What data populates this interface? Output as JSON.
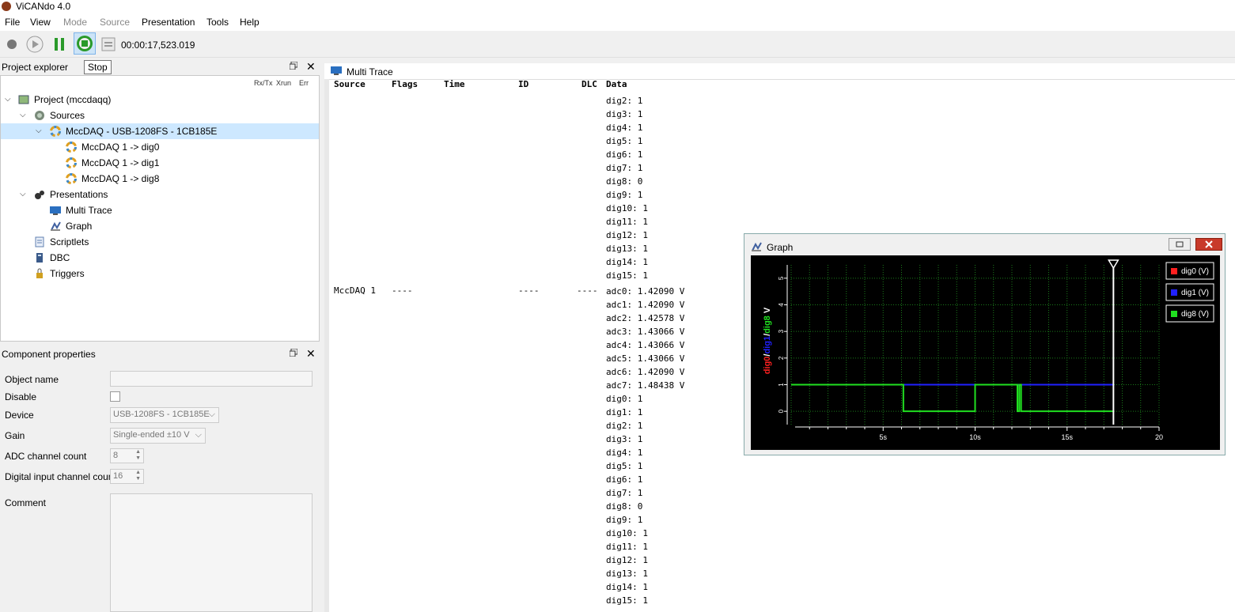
{
  "app": {
    "title": "ViCANdo 4.0"
  },
  "menu": [
    {
      "label": "File",
      "disabled": false
    },
    {
      "label": "View",
      "disabled": false
    },
    {
      "label": "Mode",
      "disabled": true
    },
    {
      "label": "Source",
      "disabled": true
    },
    {
      "label": "Presentation",
      "disabled": false
    },
    {
      "label": "Tools",
      "disabled": false
    },
    {
      "label": "Help",
      "disabled": false
    }
  ],
  "toolbar": {
    "timecode": "00:00:17,523.019",
    "tooltip": "Stop"
  },
  "explorer": {
    "title": "Project explorer",
    "columns": [
      "Rx/Tx",
      "Xrun",
      "Err"
    ],
    "tree": [
      {
        "label": "Project (mccdaqq)",
        "icon": "project-icon"
      },
      {
        "label": "Sources",
        "icon": "sources-icon"
      },
      {
        "label": "MccDAQ - USB-1208FS - 1CB185E",
        "icon": "mccdaq-ring-icon"
      },
      {
        "label": "MccDAQ 1 -> dig0",
        "icon": "mccdaq-ring-icon"
      },
      {
        "label": "MccDAQ 1 -> dig1",
        "icon": "mccdaq-ring-icon"
      },
      {
        "label": "MccDAQ 1 -> dig8",
        "icon": "mccdaq-ring-icon"
      },
      {
        "label": "Presentations",
        "icon": "presentations-icon"
      },
      {
        "label": "Multi Trace",
        "icon": "monitor-icon"
      },
      {
        "label": "Graph",
        "icon": "graph-icon"
      },
      {
        "label": "Scriptlets",
        "icon": "scriptlets-icon"
      },
      {
        "label": "DBC",
        "icon": "dbc-icon"
      },
      {
        "label": "Triggers",
        "icon": "trigger-icon"
      }
    ]
  },
  "props": {
    "title": "Component properties",
    "object_name_label": "Object name",
    "object_name_value": "",
    "disable_label": "Disable",
    "device_label": "Device",
    "device_value": "USB-1208FS - 1CB185E",
    "gain_label": "Gain",
    "gain_value": "Single-ended ±10 V",
    "adc_label": "ADC channel count",
    "adc_value": "8",
    "dig_label": "Digital input channel count",
    "dig_value": "16",
    "comment_label": "Comment"
  },
  "multitrace": {
    "title": "Multi Trace",
    "headers": {
      "source": "Source",
      "flags": "Flags",
      "time": "Time",
      "id": "ID",
      "dlc": "DLC",
      "data": "Data"
    },
    "top_lines": "dig2: 1\ndig3: 1\ndig4: 1\ndig5: 1\ndig6: 1\ndig7: 1\ndig8: 0\ndig9: 1\ndig10: 1\ndig11: 1\ndig12: 1\ndig13: 1\ndig14: 1\ndig15: 1",
    "row": {
      "source": "MccDAQ 1",
      "flags": "----",
      "id": "----",
      "dlc": "----"
    },
    "row_lines": "adc0: 1.42090 V\nadc1: 1.42090 V\nadc2: 1.42578 V\nadc3: 1.43066 V\nadc4: 1.43066 V\nadc5: 1.43066 V\nadc6: 1.42090 V\nadc7: 1.48438 V\ndig0: 1\ndig1: 1\ndig2: 1\ndig3: 1\ndig4: 1\ndig5: 1\ndig6: 1\ndig7: 1\ndig8: 0\ndig9: 1\ndig10: 1\ndig11: 1\ndig12: 1\ndig13: 1\ndig14: 1\ndig15: 1"
  },
  "graph": {
    "title": "Graph",
    "ylabel_parts": [
      {
        "text": "dig0",
        "color": "#ff2020"
      },
      {
        "text": "/",
        "color": "#ffffff"
      },
      {
        "text": "dig1",
        "color": "#2020ff"
      },
      {
        "text": "/",
        "color": "#ffffff"
      },
      {
        "text": "dig8",
        "color": "#20e020"
      },
      {
        "text": " V",
        "color": "#ffffff"
      }
    ],
    "legend": [
      {
        "name": "dig0 (V)",
        "color": "#ff2020"
      },
      {
        "name": "dig1 (V)",
        "color": "#2020ff"
      },
      {
        "name": "dig8 (V)",
        "color": "#20e020"
      }
    ]
  },
  "chart_data": {
    "type": "line",
    "xlabel": "",
    "ylabel": "dig0/dig1/dig8 V",
    "xlim": [
      0,
      20
    ],
    "ylim": [
      -0.5,
      5.5
    ],
    "x_ticks": [
      "5s",
      "10s",
      "15s",
      "20"
    ],
    "y_ticks": [
      "0",
      "1",
      "2",
      "3",
      "4",
      "5"
    ],
    "cursor_x": 17.52,
    "grid": true,
    "legend_position": "right",
    "series": [
      {
        "name": "dig0 (V)",
        "color": "#ff2020",
        "points": [
          [
            0,
            1
          ],
          [
            17.52,
            1
          ]
        ]
      },
      {
        "name": "dig1 (V)",
        "color": "#2020ff",
        "points": [
          [
            0,
            1
          ],
          [
            17.52,
            1
          ]
        ]
      },
      {
        "name": "dig8 (V)",
        "color": "#20e020",
        "points": [
          [
            0,
            1
          ],
          [
            6.1,
            1
          ],
          [
            6.1,
            0
          ],
          [
            10.0,
            0
          ],
          [
            10.0,
            1
          ],
          [
            12.3,
            1
          ],
          [
            12.3,
            0
          ],
          [
            12.4,
            0
          ],
          [
            12.4,
            1
          ],
          [
            12.5,
            1
          ],
          [
            12.5,
            0
          ],
          [
            17.52,
            0
          ]
        ]
      }
    ]
  }
}
